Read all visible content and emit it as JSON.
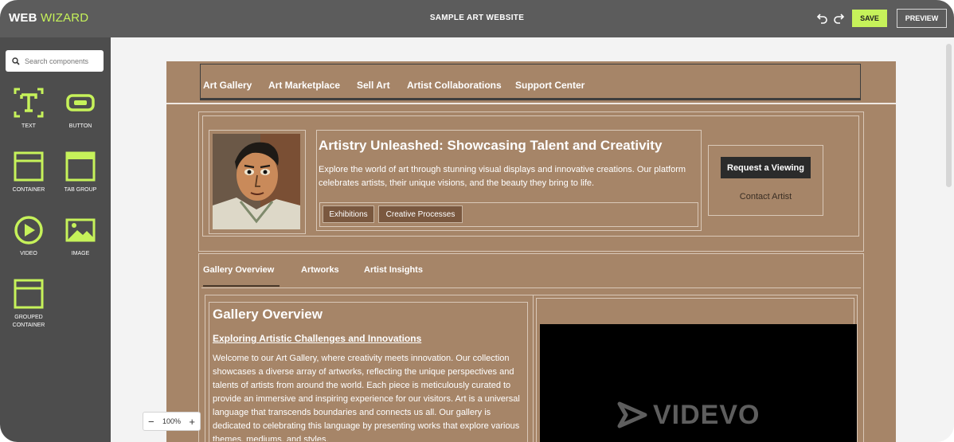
{
  "app": {
    "logo_part1": "WEB",
    "logo_part2": "WIZARD",
    "site_title": "SAMPLE ART WEBSITE",
    "save_label": "SAVE",
    "preview_label": "PREVIEW",
    "accent_color": "#c6f25a"
  },
  "sidebar": {
    "search_placeholder": "Search components",
    "components": [
      {
        "label": "TEXT",
        "icon": "text-icon"
      },
      {
        "label": "BUTTON",
        "icon": "button-icon"
      },
      {
        "label": "CONTAINER",
        "icon": "container-icon"
      },
      {
        "label": "TAB GROUP",
        "icon": "tab-group-icon"
      },
      {
        "label": "VIDEO",
        "icon": "play-icon"
      },
      {
        "label": "IMAGE",
        "icon": "image-icon"
      },
      {
        "label": "GROUPED CONTAINER",
        "icon": "grouped-container-icon"
      }
    ]
  },
  "site": {
    "nav": [
      "Art Gallery",
      "Art Marketplace",
      "Sell Art",
      "Artist Collaborations",
      "Support Center"
    ],
    "hero": {
      "title": "Artistry Unleashed: Showcasing Talent and Creativity",
      "description": "Explore the world of art through stunning visual displays and innovative creations. Our platform celebrates artists, their unique visions, and the beauty they bring to life.",
      "tags": [
        "Exhibitions",
        "Creative Processes"
      ],
      "cta_primary": "Request a Viewing",
      "cta_secondary": "Contact Artist"
    },
    "tabs": [
      "Gallery Overview",
      "Artworks",
      "Artist Insights"
    ],
    "overview": {
      "title": "Gallery Overview",
      "subtitle": "Exploring Artistic Challenges and Innovations",
      "body": "Welcome to our Art Gallery, where creativity meets innovation. Our collection showcases a diverse array of artworks, reflecting the unique perspectives and talents of artists from around the world. Each piece is meticulously curated to provide an immersive and inspiring experience for our visitors. Art is a universal language that transcends boundaries and connects us all. Our gallery is dedicated to celebrating this language by presenting works that explore various themes, mediums, and styles."
    },
    "video_watermark": "VIDEVO"
  },
  "zoom": {
    "level": "100%",
    "minus": "−",
    "plus": "+"
  }
}
